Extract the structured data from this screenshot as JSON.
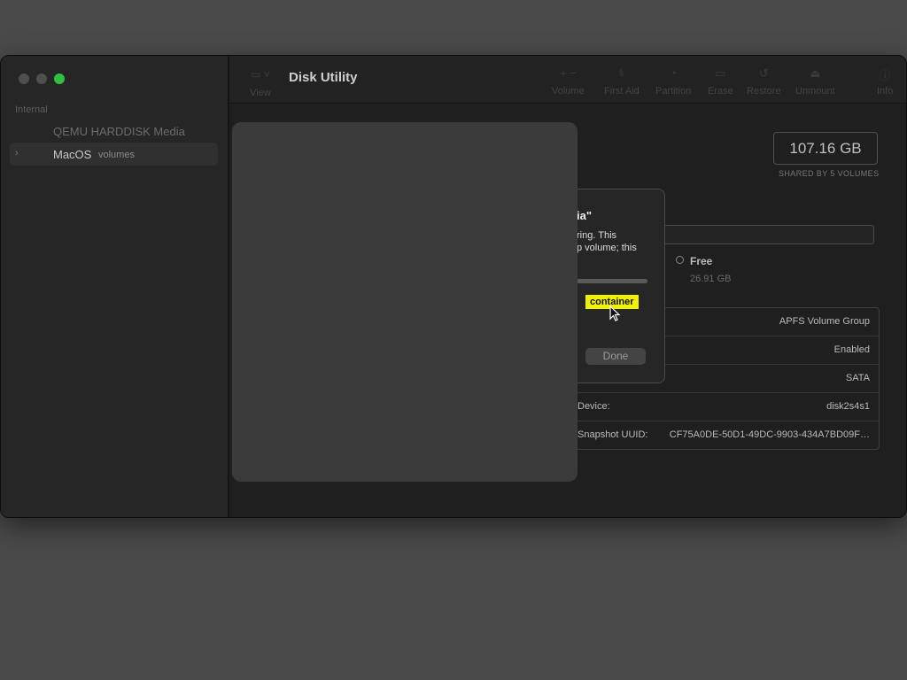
{
  "app": {
    "title": "Disk Utility"
  },
  "sidebar": {
    "section": "Internal",
    "items": [
      {
        "label": "QEMU HARDDISK Media",
        "sub": ""
      },
      {
        "label": "MacOS",
        "sub": "volumes"
      }
    ]
  },
  "toolbar": {
    "view": "View",
    "tools": [
      "Volume",
      "First Aid",
      "Partition",
      "Erase",
      "Restore",
      "Unmount",
      "Info"
    ]
  },
  "capacity": {
    "value": "107.16 GB",
    "shared": "SHARED BY 5 VOLUMES"
  },
  "usage": {
    "used_fraction": 0.2,
    "free_label": "Free",
    "free_value": "26.91 GB"
  },
  "info_rows": [
    {
      "key": "",
      "value": "APFS Volume Group"
    },
    {
      "key": "",
      "value": "Enabled"
    },
    {
      "key": "",
      "value": "SATA"
    },
    {
      "key": "Device:",
      "value": "disk2s4s1"
    },
    {
      "key": "Snapshot UUID:",
      "value": "CF75A0DE-50D1-49DC-9903-434A7BD09F…"
    }
  ],
  "dialog": {
    "title": "ia\"",
    "body_line1": "ring. This",
    "body_line2": "p volume; this",
    "status": "container",
    "progress": 1.0,
    "done_label": "Done"
  }
}
